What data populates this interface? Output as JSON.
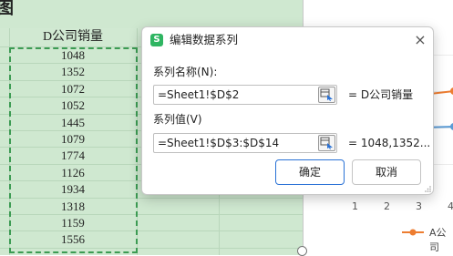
{
  "sheet": {
    "top_glyph": "图",
    "header": "D公司销量",
    "values": [
      "1048",
      "1352",
      "1072",
      "1052",
      "1445",
      "1079",
      "1774",
      "1126",
      "1934",
      "1318",
      "1159",
      "1556"
    ]
  },
  "chart": {
    "x_ticks": [
      "1",
      "2",
      "3",
      "4"
    ],
    "legend_partial": "A公司"
  },
  "dialog": {
    "app_icon_letter": "S",
    "title": "编辑数据系列",
    "close_glyph": "×",
    "series_name_label": "系列名称(N):",
    "series_name_value": "=Sheet1!$D$2",
    "series_name_preview": "= D公司销量",
    "series_values_label": "系列值(V)",
    "series_values_value": "=Sheet1!$D$3:$D$14",
    "series_values_preview": "= 1048,1352...",
    "ok_label": "确定",
    "cancel_label": "取消"
  },
  "colors": {
    "sheet_bg": "#cfe8d0",
    "selection_border": "#3c9b53",
    "ok_border": "#2a72d6",
    "app_icon": "#2fb562",
    "series_orange": "#ed7d31",
    "series_blue": "#5b9bd5"
  }
}
